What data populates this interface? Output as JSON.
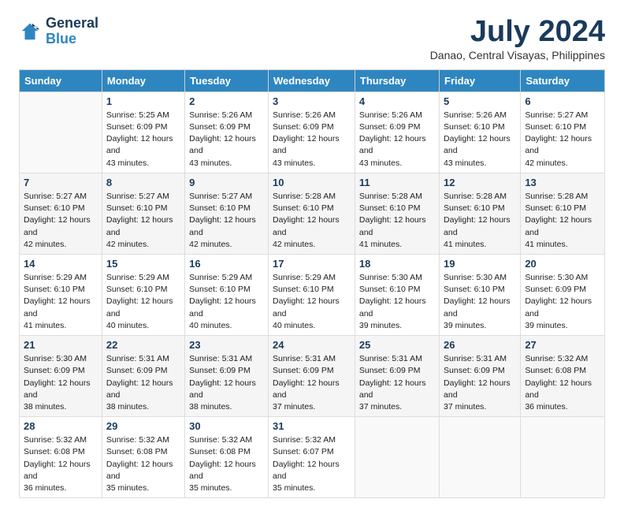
{
  "logo": {
    "line1": "General",
    "line2": "Blue"
  },
  "title": "July 2024",
  "subtitle": "Danao, Central Visayas, Philippines",
  "weekdays": [
    "Sunday",
    "Monday",
    "Tuesday",
    "Wednesday",
    "Thursday",
    "Friday",
    "Saturday"
  ],
  "weeks": [
    [
      {
        "day": "",
        "sunrise": "",
        "sunset": "",
        "daylight": ""
      },
      {
        "day": "1",
        "sunrise": "Sunrise: 5:25 AM",
        "sunset": "Sunset: 6:09 PM",
        "daylight": "Daylight: 12 hours and 43 minutes."
      },
      {
        "day": "2",
        "sunrise": "Sunrise: 5:26 AM",
        "sunset": "Sunset: 6:09 PM",
        "daylight": "Daylight: 12 hours and 43 minutes."
      },
      {
        "day": "3",
        "sunrise": "Sunrise: 5:26 AM",
        "sunset": "Sunset: 6:09 PM",
        "daylight": "Daylight: 12 hours and 43 minutes."
      },
      {
        "day": "4",
        "sunrise": "Sunrise: 5:26 AM",
        "sunset": "Sunset: 6:09 PM",
        "daylight": "Daylight: 12 hours and 43 minutes."
      },
      {
        "day": "5",
        "sunrise": "Sunrise: 5:26 AM",
        "sunset": "Sunset: 6:10 PM",
        "daylight": "Daylight: 12 hours and 43 minutes."
      },
      {
        "day": "6",
        "sunrise": "Sunrise: 5:27 AM",
        "sunset": "Sunset: 6:10 PM",
        "daylight": "Daylight: 12 hours and 42 minutes."
      }
    ],
    [
      {
        "day": "7",
        "sunrise": "Sunrise: 5:27 AM",
        "sunset": "Sunset: 6:10 PM",
        "daylight": "Daylight: 12 hours and 42 minutes."
      },
      {
        "day": "8",
        "sunrise": "Sunrise: 5:27 AM",
        "sunset": "Sunset: 6:10 PM",
        "daylight": "Daylight: 12 hours and 42 minutes."
      },
      {
        "day": "9",
        "sunrise": "Sunrise: 5:27 AM",
        "sunset": "Sunset: 6:10 PM",
        "daylight": "Daylight: 12 hours and 42 minutes."
      },
      {
        "day": "10",
        "sunrise": "Sunrise: 5:28 AM",
        "sunset": "Sunset: 6:10 PM",
        "daylight": "Daylight: 12 hours and 42 minutes."
      },
      {
        "day": "11",
        "sunrise": "Sunrise: 5:28 AM",
        "sunset": "Sunset: 6:10 PM",
        "daylight": "Daylight: 12 hours and 41 minutes."
      },
      {
        "day": "12",
        "sunrise": "Sunrise: 5:28 AM",
        "sunset": "Sunset: 6:10 PM",
        "daylight": "Daylight: 12 hours and 41 minutes."
      },
      {
        "day": "13",
        "sunrise": "Sunrise: 5:28 AM",
        "sunset": "Sunset: 6:10 PM",
        "daylight": "Daylight: 12 hours and 41 minutes."
      }
    ],
    [
      {
        "day": "14",
        "sunrise": "Sunrise: 5:29 AM",
        "sunset": "Sunset: 6:10 PM",
        "daylight": "Daylight: 12 hours and 41 minutes."
      },
      {
        "day": "15",
        "sunrise": "Sunrise: 5:29 AM",
        "sunset": "Sunset: 6:10 PM",
        "daylight": "Daylight: 12 hours and 40 minutes."
      },
      {
        "day": "16",
        "sunrise": "Sunrise: 5:29 AM",
        "sunset": "Sunset: 6:10 PM",
        "daylight": "Daylight: 12 hours and 40 minutes."
      },
      {
        "day": "17",
        "sunrise": "Sunrise: 5:29 AM",
        "sunset": "Sunset: 6:10 PM",
        "daylight": "Daylight: 12 hours and 40 minutes."
      },
      {
        "day": "18",
        "sunrise": "Sunrise: 5:30 AM",
        "sunset": "Sunset: 6:10 PM",
        "daylight": "Daylight: 12 hours and 39 minutes."
      },
      {
        "day": "19",
        "sunrise": "Sunrise: 5:30 AM",
        "sunset": "Sunset: 6:10 PM",
        "daylight": "Daylight: 12 hours and 39 minutes."
      },
      {
        "day": "20",
        "sunrise": "Sunrise: 5:30 AM",
        "sunset": "Sunset: 6:09 PM",
        "daylight": "Daylight: 12 hours and 39 minutes."
      }
    ],
    [
      {
        "day": "21",
        "sunrise": "Sunrise: 5:30 AM",
        "sunset": "Sunset: 6:09 PM",
        "daylight": "Daylight: 12 hours and 38 minutes."
      },
      {
        "day": "22",
        "sunrise": "Sunrise: 5:31 AM",
        "sunset": "Sunset: 6:09 PM",
        "daylight": "Daylight: 12 hours and 38 minutes."
      },
      {
        "day": "23",
        "sunrise": "Sunrise: 5:31 AM",
        "sunset": "Sunset: 6:09 PM",
        "daylight": "Daylight: 12 hours and 38 minutes."
      },
      {
        "day": "24",
        "sunrise": "Sunrise: 5:31 AM",
        "sunset": "Sunset: 6:09 PM",
        "daylight": "Daylight: 12 hours and 37 minutes."
      },
      {
        "day": "25",
        "sunrise": "Sunrise: 5:31 AM",
        "sunset": "Sunset: 6:09 PM",
        "daylight": "Daylight: 12 hours and 37 minutes."
      },
      {
        "day": "26",
        "sunrise": "Sunrise: 5:31 AM",
        "sunset": "Sunset: 6:09 PM",
        "daylight": "Daylight: 12 hours and 37 minutes."
      },
      {
        "day": "27",
        "sunrise": "Sunrise: 5:32 AM",
        "sunset": "Sunset: 6:08 PM",
        "daylight": "Daylight: 12 hours and 36 minutes."
      }
    ],
    [
      {
        "day": "28",
        "sunrise": "Sunrise: 5:32 AM",
        "sunset": "Sunset: 6:08 PM",
        "daylight": "Daylight: 12 hours and 36 minutes."
      },
      {
        "day": "29",
        "sunrise": "Sunrise: 5:32 AM",
        "sunset": "Sunset: 6:08 PM",
        "daylight": "Daylight: 12 hours and 35 minutes."
      },
      {
        "day": "30",
        "sunrise": "Sunrise: 5:32 AM",
        "sunset": "Sunset: 6:08 PM",
        "daylight": "Daylight: 12 hours and 35 minutes."
      },
      {
        "day": "31",
        "sunrise": "Sunrise: 5:32 AM",
        "sunset": "Sunset: 6:07 PM",
        "daylight": "Daylight: 12 hours and 35 minutes."
      },
      {
        "day": "",
        "sunrise": "",
        "sunset": "",
        "daylight": ""
      },
      {
        "day": "",
        "sunrise": "",
        "sunset": "",
        "daylight": ""
      },
      {
        "day": "",
        "sunrise": "",
        "sunset": "",
        "daylight": ""
      }
    ]
  ]
}
